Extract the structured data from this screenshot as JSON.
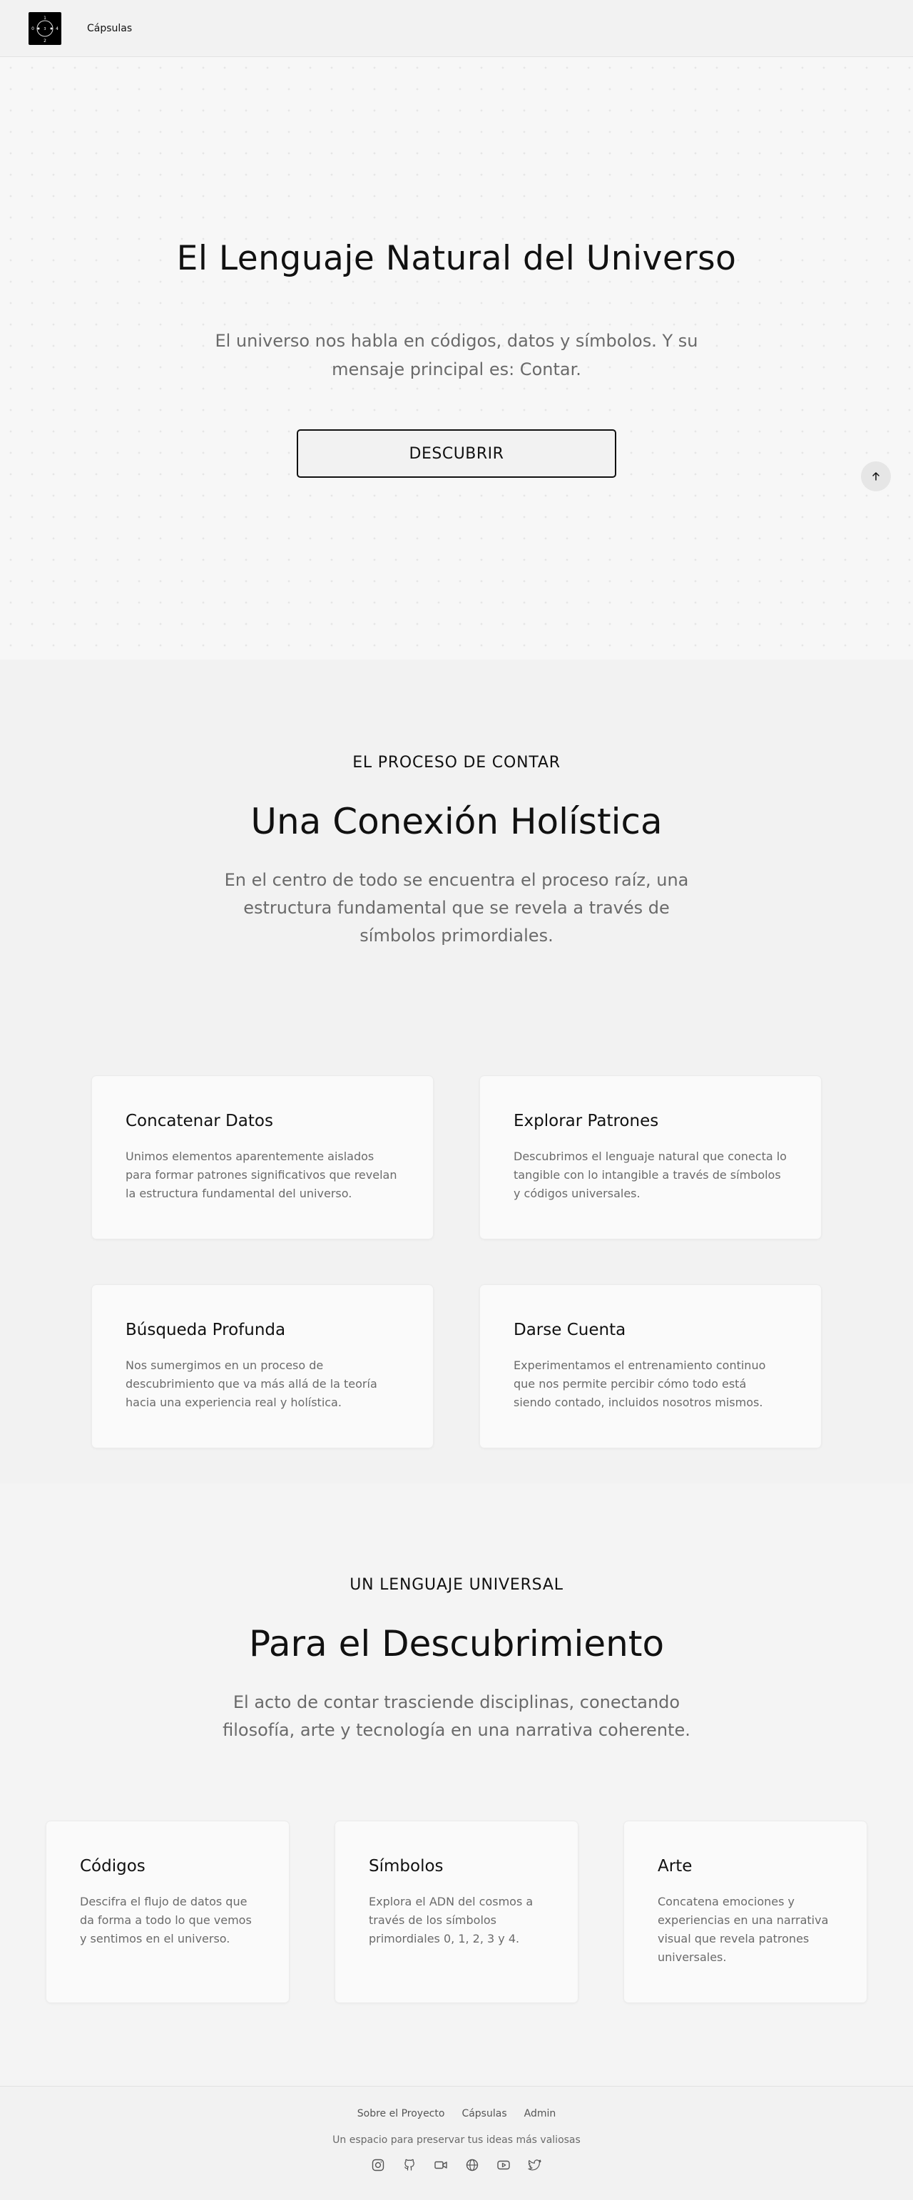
{
  "header": {
    "logo_alt": "logo",
    "nav": [
      {
        "label": "Cápsulas"
      }
    ]
  },
  "hero": {
    "title": "El Lenguaje Natural del Universo",
    "subtitle": "El universo nos habla en códigos, datos y símbolos. Y su mensaje principal es: Contar.",
    "button": "DESCUBRIR"
  },
  "process": {
    "eyebrow": "EL PROCESO DE CONTAR",
    "title": "Una Conexión Holística",
    "subtitle": "En el centro de todo se encuentra el proceso raíz, una estructura fundamental que se revela a través de símbolos primordiales.",
    "cards": [
      {
        "title": "Concatenar Datos",
        "text": "Unimos elementos aparentemente aislados para formar patrones significativos que revelan la estructura fundamental del universo."
      },
      {
        "title": "Explorar Patrones",
        "text": "Descubrimos el lenguaje natural que conecta lo tangible con lo intangible a través de símbolos y códigos universales."
      },
      {
        "title": "Búsqueda Profunda",
        "text": "Nos sumergimos en un proceso de descubrimiento que va más allá de la teoría hacia una experiencia real y holística."
      },
      {
        "title": "Darse Cuenta",
        "text": "Experimentamos el entrenamiento continuo que nos permite percibir cómo todo está siendo contado, incluidos nosotros mismos."
      }
    ]
  },
  "universal": {
    "eyebrow": "UN LENGUAJE UNIVERSAL",
    "title": "Para el Descubrimiento",
    "subtitle": "El acto de contar trasciende disciplinas, conectando filosofía, arte y tecnología en una narrativa coherente.",
    "cards": [
      {
        "title": "Códigos",
        "text": "Descifra el flujo de datos que da forma a todo lo que vemos y sentimos en el universo."
      },
      {
        "title": "Símbolos",
        "text": "Explora el ADN del cosmos a través de los símbolos primordiales 0, 1, 2, 3 y 4."
      },
      {
        "title": "Arte",
        "text": "Concatena emociones y experiencias en una narrativa visual que revela patrones universales."
      }
    ]
  },
  "footer": {
    "links": [
      {
        "label": "Sobre el Proyecto"
      },
      {
        "label": "Cápsulas"
      },
      {
        "label": "Admin"
      }
    ],
    "tagline": "Un espacio para preservar tus ideas más valiosas",
    "icons": [
      "instagram-icon",
      "github-icon",
      "video-icon",
      "globe-icon",
      "youtube-icon",
      "twitter-icon"
    ]
  }
}
